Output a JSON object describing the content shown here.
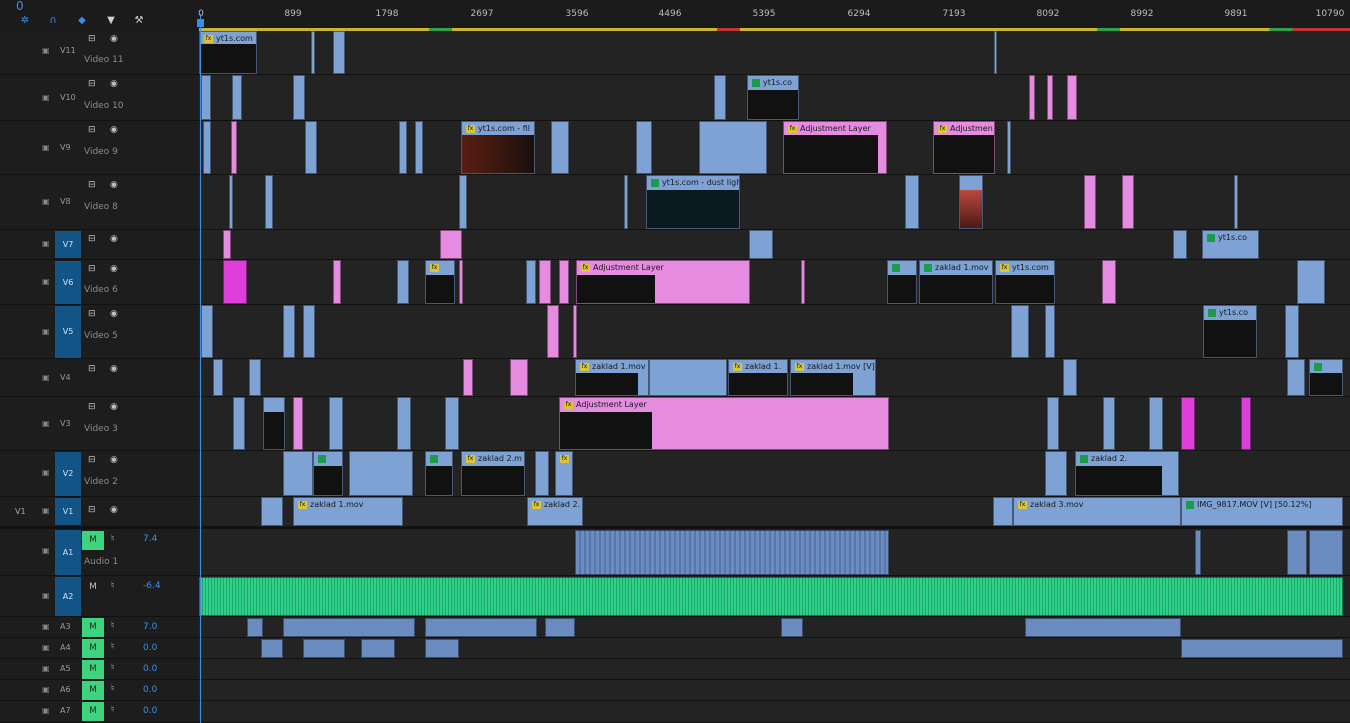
{
  "timeline": {
    "timecode": "0",
    "ruler_ticks": [
      "0",
      "899",
      "1798",
      "2697",
      "3596",
      "4496",
      "5395",
      "6294",
      "7193",
      "8092",
      "8992",
      "9891",
      "10790"
    ]
  },
  "toolbar": {
    "icons": [
      "snap-icon",
      "linked-selection-icon",
      "add-marker-icon",
      "marker-icon",
      "wrench-icon"
    ]
  },
  "tracks": {
    "video": [
      {
        "id": "V11",
        "name": "Video 11"
      },
      {
        "id": "V10",
        "name": "Video 10"
      },
      {
        "id": "V9",
        "name": "Video 9"
      },
      {
        "id": "V8",
        "name": "Video 8"
      },
      {
        "id": "V7",
        "name": ""
      },
      {
        "id": "V6",
        "name": "Video 6"
      },
      {
        "id": "V5",
        "name": "Video 5"
      },
      {
        "id": "V4",
        "name": ""
      },
      {
        "id": "V3",
        "name": "Video 3"
      },
      {
        "id": "V2",
        "name": "Video 2"
      },
      {
        "id": "V1",
        "name": "",
        "source": "V1"
      }
    ],
    "audio": [
      {
        "id": "A1",
        "name": "Audio 1",
        "mute": "M",
        "volume": "7.4"
      },
      {
        "id": "A2",
        "name": "",
        "mute": "M",
        "volume": "-6.4"
      },
      {
        "id": "A3",
        "name": "",
        "mute": "M",
        "volume": "7.0"
      },
      {
        "id": "A4",
        "name": "",
        "mute": "M",
        "volume": "0.0"
      },
      {
        "id": "A5",
        "name": "",
        "mute": "M",
        "volume": "0.0"
      },
      {
        "id": "A6",
        "name": "",
        "mute": "M",
        "volume": "0.0"
      },
      {
        "id": "A7",
        "name": "",
        "mute": "M",
        "volume": "0.0"
      }
    ]
  },
  "clip_labels": {
    "v11_a": "yt1s.com",
    "v10_a": "yt1s.co",
    "v9_a": "yt1s.com - fil",
    "v9_b": "Adjustment Layer",
    "v9_c": "Adjustmen",
    "v8_a": "yt1s.com - dust ligh",
    "v7_a": "yt1s.co",
    "v6_a": "Adjustment Layer",
    "v6_b": "zaklad 1.mov",
    "v6_c": "yt1s.com",
    "v5_a": "yt1s.co",
    "v4_a": "zaklad 1.mov [",
    "v4_b": "zaklad 1.",
    "v4_c": "zaklad 1.mov [V]",
    "v3_a": "Adjustment Layer",
    "v2_a": "zaklad 2.m",
    "v2_b": "zaklad 2.",
    "v1_a": "zaklad 1.mov",
    "v1_b": "zaklad 2.",
    "v1_c": "zaklad 3.mov",
    "v1_d": "IMG_9817.MOV [V] [50.12%]"
  },
  "colors": {
    "video_clip": "#7fa2d4",
    "adjustment_layer": "#e58be0",
    "audio_clip": "#6a8cc0",
    "music_clip": "#2fd08a",
    "playhead": "#3b8ee8",
    "track_target": "#135486",
    "mute_button": "#3ed37f"
  }
}
